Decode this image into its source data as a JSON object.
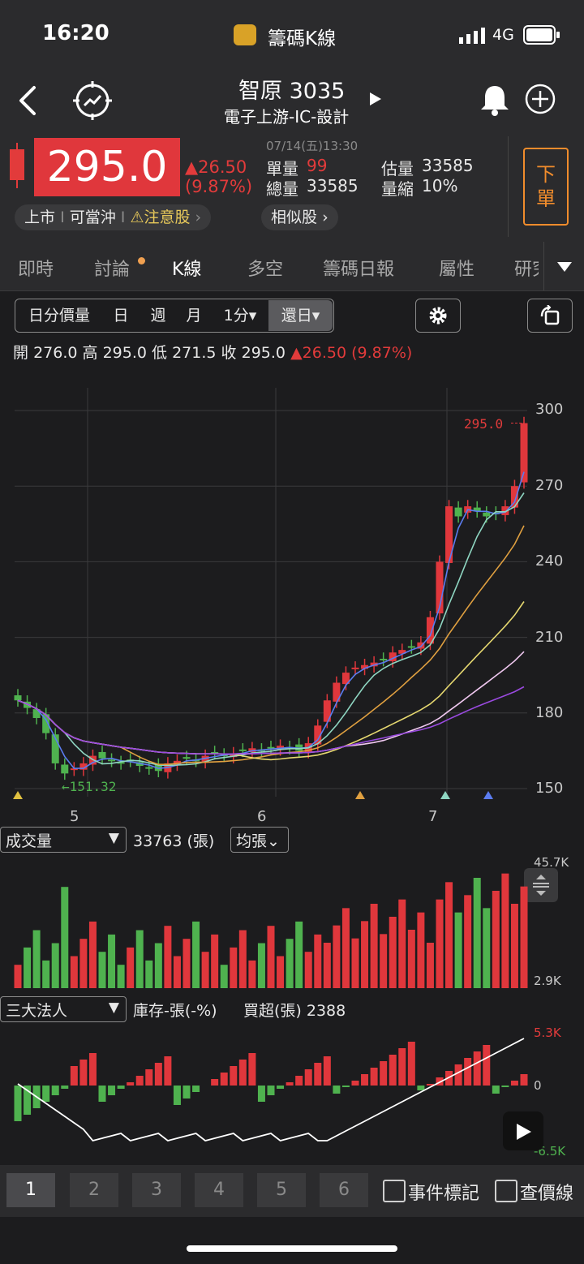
{
  "status_bar": {
    "time": "16:20",
    "app_name": "籌碼K線",
    "network": "4G"
  },
  "header": {
    "stock_title": "智原 3035",
    "category": "電子上游-IC-設計"
  },
  "quote": {
    "price": "295.0",
    "change": "▲26.50",
    "change_pct": "(9.87%)",
    "datetime": "07/14(五)13:30",
    "unit_vol_label": "單量",
    "unit_vol_value": "99",
    "total_vol_label": "總量",
    "total_vol_value": "33585",
    "est_vol_label": "估量",
    "est_vol_value": "33585",
    "shrink_label": "量縮",
    "shrink_value": "10%",
    "order_button": "下單",
    "tag_market": "上市",
    "tag_daytrade": "可當沖",
    "tag_attention": "⚠注意股",
    "similar": "相似股"
  },
  "tabs": [
    "即時",
    "討論",
    "K線",
    "多空",
    "籌碼日報",
    "屬性",
    "研究"
  ],
  "chart_toolbar": {
    "items": [
      "日分價量",
      "日",
      "週",
      "月",
      "1分▾",
      "還日▾"
    ]
  },
  "ohlc": {
    "open_label": "開",
    "open": "276.0",
    "high_label": "高",
    "high": "295.0",
    "low_label": "低",
    "low": "271.5",
    "close_label": "收",
    "close": "295.0",
    "change": "▲26.50 (9.87%)"
  },
  "chart_data": [
    {
      "type": "candlestick",
      "price_axis": [
        "300",
        "270",
        "240",
        "210",
        "180",
        "150"
      ],
      "ylim": [
        150,
        300
      ],
      "month_labels": [
        "5",
        "6",
        "7"
      ],
      "last_price_label": "295.0",
      "low_marker_label": "←151.32",
      "close_series": [
        185,
        182,
        178,
        172,
        160,
        156,
        158,
        160,
        163,
        162,
        161,
        160,
        161,
        159,
        158,
        157,
        160,
        161,
        162,
        161,
        163,
        164,
        163,
        164,
        165,
        166,
        165,
        166,
        167,
        166,
        165,
        168,
        175,
        185,
        192,
        196,
        198,
        199,
        200,
        201,
        204,
        205,
        206,
        208,
        218,
        240,
        262,
        258,
        262,
        260,
        258,
        259,
        262,
        270,
        295
      ]
    },
    {
      "type": "bar",
      "title": "成交量",
      "value_label": "33763 (張)",
      "avg_button": "均張⌄",
      "ylim_labels": [
        "45.7K",
        "2.9K"
      ]
    },
    {
      "type": "bar",
      "title": "三大法人",
      "inventory_label": "庫存-張(-%)",
      "net_buy_label": "買超(張) 2388",
      "ylim_labels": [
        "5.3K",
        "0",
        "-6.5K"
      ]
    }
  ],
  "footer": {
    "tabs": [
      "1",
      "2",
      "3",
      "4",
      "5",
      "6"
    ],
    "event_marker": "事件標記",
    "price_line": "查價線"
  }
}
